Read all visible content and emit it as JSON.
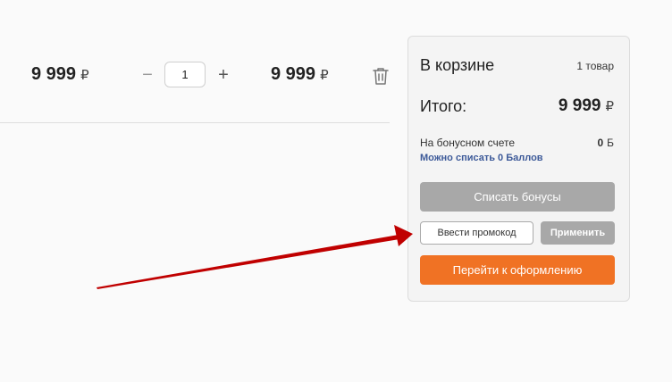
{
  "item": {
    "price": "9 999",
    "currency": "₽",
    "quantity": "1",
    "minus": "−",
    "plus": "+",
    "total": "9 999"
  },
  "cart": {
    "title": "В корзине",
    "count": "1 товар",
    "total_label": "Итого:",
    "total_value": "9 999",
    "currency": "₽",
    "bonus_label": "На бонусном счете",
    "bonus_value": "0",
    "bonus_unit": "Б",
    "bonus_link": "Можно списать 0 Баллов",
    "bonus_button": "Списать бонусы",
    "promo_placeholder": "Ввести промокод",
    "apply_button": "Применить",
    "checkout_button": "Перейти к оформлению"
  },
  "icons": {
    "trash": "trash-icon",
    "arrow": "arrow-annotation"
  },
  "colors": {
    "accent": "#f07224",
    "disabled": "#a8a8a8",
    "link": "#3d5a99",
    "arrow": "#c00000"
  }
}
